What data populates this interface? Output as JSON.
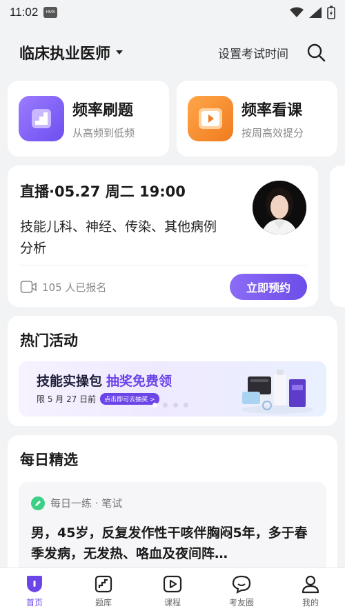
{
  "status": {
    "time": "11:02",
    "badge": "HMS"
  },
  "header": {
    "title": "临床执业医师",
    "set_exam_time": "设置考试时间"
  },
  "quick_actions": [
    {
      "title": "频率刷题",
      "subtitle": "从高频到低频",
      "color": "#7b5cf5"
    },
    {
      "title": "频率看课",
      "subtitle": "按周高效提分",
      "color": "#f5862a"
    }
  ],
  "live": {
    "title": "直播·05.27 周二 19:00",
    "description": "技能儿科、神经、传染、其他病例分析",
    "enroll_count": "105 人已报名",
    "reserve_label": "立即预约"
  },
  "hot_activity": {
    "title": "热门活动",
    "banner": {
      "title_main": "技能实操包",
      "title_accent": "抽奖免费领",
      "subtitle": "限 5 月 27 日前",
      "pill": "点击即可去抽奖 >"
    }
  },
  "daily": {
    "title": "每日精选",
    "question_meta": "每日一练 · 笔试",
    "question_text": "男，45岁，反复发作性干咳伴胸闷5年，多于春季发病，无发热、咯血及夜间阵…"
  },
  "tabs": [
    {
      "label": "首页",
      "active": true
    },
    {
      "label": "题库",
      "active": false
    },
    {
      "label": "课程",
      "active": false
    },
    {
      "label": "考友圈",
      "active": false
    },
    {
      "label": "我的",
      "active": false
    }
  ],
  "colors": {
    "accent": "#6b45e8",
    "background": "#f2f3f5"
  }
}
